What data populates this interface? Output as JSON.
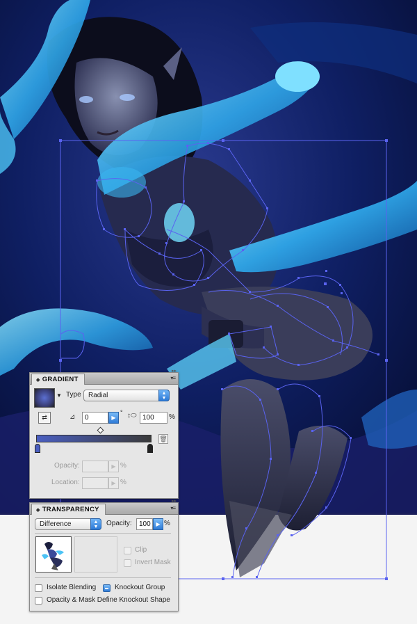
{
  "gradient_panel": {
    "title": "GRADIENT",
    "type_label": "Type",
    "type_value": "Radial",
    "angle_value": "0",
    "degree_symbol": "°",
    "aspect_value": "100",
    "aspect_unit": "%",
    "opacity_label": "Opacity:",
    "opacity_unit": "%",
    "location_label": "Location:",
    "location_unit": "%",
    "colors": {
      "start": "#4a5fc1",
      "end": "#3a3a3a"
    }
  },
  "transparency_panel": {
    "title": "TRANSPARENCY",
    "blend_mode": "Difference",
    "opacity_label": "Opacity:",
    "opacity_value": "100",
    "opacity_unit": "%",
    "clip_label": "Clip",
    "invert_mask_label": "Invert Mask",
    "isolate_blending_label": "Isolate Blending",
    "knockout_group_label": "Knockout Group",
    "knockout_group_state": "mixed",
    "opacity_mask_label": "Opacity & Mask Define Knockout Shape"
  },
  "colors": {
    "selection": "#5a63f0",
    "accent_button": "#2f7bd7",
    "artwork_bg": "#0b1a52"
  }
}
